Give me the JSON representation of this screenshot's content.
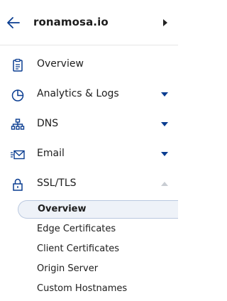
{
  "header": {
    "site_name": "ronamosa.io"
  },
  "nav": {
    "items": [
      {
        "label": "Overview",
        "icon": "clipboard-icon"
      },
      {
        "label": "Analytics & Logs",
        "icon": "pie-chart-icon"
      },
      {
        "label": "DNS",
        "icon": "network-icon"
      },
      {
        "label": "Email",
        "icon": "email-icon"
      },
      {
        "label": "SSL/TLS",
        "icon": "lock-icon"
      }
    ],
    "ssl_tls_subitems": [
      {
        "label": "Overview",
        "active": true
      },
      {
        "label": "Edge Certificates"
      },
      {
        "label": "Client Certificates"
      },
      {
        "label": "Origin Server"
      },
      {
        "label": "Custom Hostnames"
      }
    ]
  },
  "colors": {
    "accent": "#0a3d91",
    "muted_caret": "#c9cdd3",
    "active_bg": "#eef2f8"
  }
}
